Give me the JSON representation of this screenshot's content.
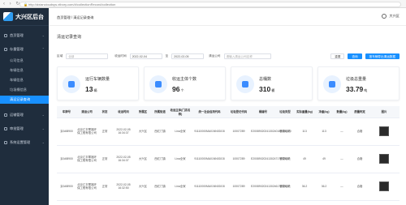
{
  "browser": {
    "url": "http://dxiancloudsys.xtbory.com/#/collectionRecord/collection"
  },
  "sidebar": {
    "title": "大兴区后台",
    "groups": [
      {
        "label": "首页管理"
      },
      {
        "label": "存量管理",
        "subs": [
          "公司信息",
          "车辆信息",
          "车辆信息",
          "垃圾桶信息",
          "清运记录查询"
        ]
      },
      {
        "label": "运输管理"
      },
      {
        "label": "审批管理"
      },
      {
        "label": "系统设置管理"
      }
    ]
  },
  "header": {
    "breadcrumb": "首页管理 / 清运记录查询",
    "user": "大兴区"
  },
  "page": {
    "title": "清运记录查询"
  },
  "filters": {
    "area_label": "区域",
    "area_value": "全部",
    "date_label": "收运时间",
    "date_from": "2022-02-04",
    "to": "至",
    "date_to": "2022-02-05",
    "company_label": "清运公司",
    "company_placeholder": "请输入清运公司名称",
    "btn_reset": "重置",
    "btn_query": "查询",
    "btn_export": "按车辆导出清运数据"
  },
  "cards": [
    {
      "label": "运行车辆数量",
      "value": "13",
      "unit": "辆"
    },
    {
      "label": "收运主体个数",
      "value": "96",
      "unit": "个"
    },
    {
      "label": "总桶数",
      "value": "310",
      "unit": "桶"
    },
    {
      "label": "垃圾总重量",
      "value": "33.79",
      "unit": "吨"
    }
  ],
  "table": {
    "headers": [
      "车牌号",
      "清运公司",
      "状态",
      "收运时间",
      "所属区",
      "所属街道",
      "收运主体(门店名称)",
      "统一社会信用代码",
      "垃圾登记代码",
      "桶编号",
      "垃圾类型",
      "实际重量(kg)",
      "净重(kg)",
      "数量(kg)",
      "质量判定",
      "图片"
    ],
    "rows": [
      [
        "京A6B900",
        "北京汇丰翠福环保工程有限公司",
        "正常",
        "2022-02-05 16:34:37",
        "大兴区",
        "西红门镇",
        "Lina全家",
        "91110000MA01NN0DG8",
        "10007289",
        "E20089020241302401694604F0",
        "餐厨垃圾",
        "113",
        "113",
        "—",
        "合格"
      ],
      [
        "京A6B900",
        "北京汇丰翠福环保工程有限公司",
        "正常",
        "2022-02-05 16:34:37",
        "大兴区",
        "西红门镇",
        "Lina全家",
        "91110000MA01NN0DG8",
        "10007289",
        "E20089020241302471700205F",
        "餐厨垃圾",
        "49",
        "49",
        "—",
        "合格"
      ],
      [
        "京A6B900",
        "北京汇丰翠福环保工程有限公司",
        "正常",
        "2022-02-05 16:32:50",
        "大兴区",
        "西红门镇",
        "Lina全家",
        "91110000MA01NN0DG8",
        "10007289",
        "E20089020241302461700200F",
        "餐厨垃圾",
        "36.2",
        "36.2",
        "—",
        "合格"
      ]
    ]
  }
}
